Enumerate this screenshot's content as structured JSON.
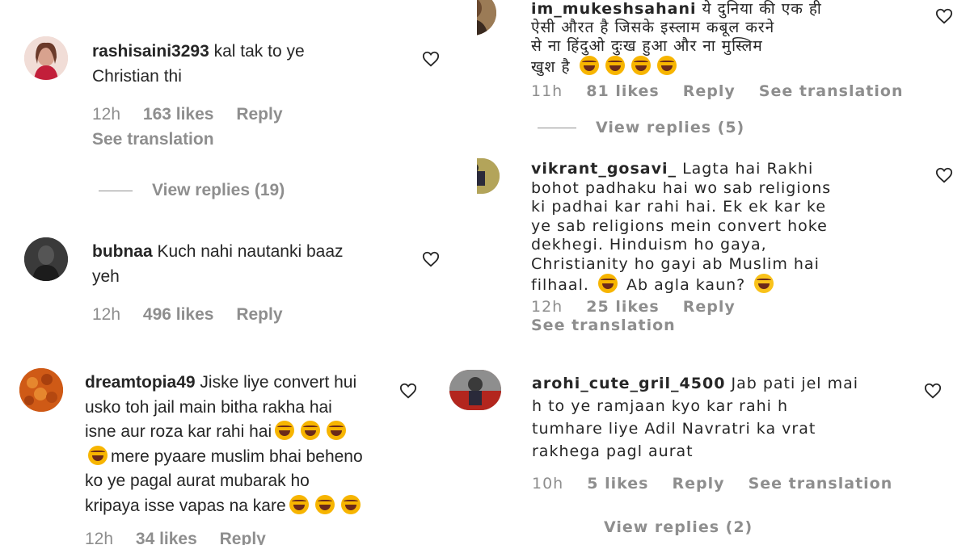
{
  "comments": {
    "rashisaini": {
      "username": "rashisaini3293",
      "line1": "kal tak to ye",
      "line2": "Christian thi",
      "time": "12h",
      "likes": "163 likes",
      "reply": "Reply",
      "see_translation": "See translation",
      "view_replies": "View replies (19)"
    },
    "bubnaa": {
      "username": "bubnaa",
      "line1": "Kuch nahi nautanki baaz",
      "line2": "yeh",
      "time": "12h",
      "likes": "496 likes",
      "reply": "Reply"
    },
    "mukesh": {
      "username": "im_mukeshsahani",
      "line1": "ये दुनिया की एक ही",
      "line2": "ऐसी औरत है जिसके इस्लाम कबूल करने",
      "line3": "से ना हिंदुओ दुःख हुआ और ना मुस्लिम",
      "line4": "खुश है",
      "time": "11h",
      "likes": "81 likes",
      "reply": "Reply",
      "see_translation": "See translation",
      "view_replies": "View replies (5)"
    },
    "vikrant": {
      "username": "vikrant_gosavi_",
      "line1": "Lagta hai Rakhi",
      "line2": "bohot padhaku hai wo sab religions",
      "line3": "ki padhai kar rahi hai. Ek ek kar ke",
      "line4": "ye sab religions mein convert hoke",
      "line5": "dekhegi. Hinduism ho gaya,",
      "line6": "Christianity ho gayi ab Muslim hai",
      "line7a": "filhaal.",
      "line7b": "Ab agla kaun?",
      "time": "12h",
      "likes": "25 likes",
      "reply": "Reply",
      "see_translation": "See translation"
    },
    "dreamtopia": {
      "username": "dreamtopia49",
      "line1": "Jiske liye convert hui",
      "line2": "usko toh jail main bitha rakha hai",
      "line3": "isne aur roza kar rahi hai",
      "line4": "mere pyaare muslim bhai beheno",
      "line5": "ko ye pagal aurat mubarak ho",
      "line6": "kripaya isse vapas na kare",
      "time": "12h",
      "likes": "34 likes",
      "reply": "Reply"
    },
    "arohi": {
      "username": "arohi_cute_gril_4500",
      "line1": "Jab pati jel mai",
      "line2": "h to ye ramjaan kyo kar rahi h",
      "line3": "tumhare liye Adil Navratri ka vrat",
      "line4": "rakhega pagl aurat",
      "time": "10h",
      "likes": "5 likes",
      "reply": "Reply",
      "see_translation": "See translation",
      "view_replies": "View replies (2)"
    }
  },
  "icons": {
    "heart": "heart-outline-icon",
    "emoji": "laughing-tears-emoji-icon"
  },
  "colors": {
    "text": "#262626",
    "muted": "#8e8e8e",
    "emoji": "#f7b500"
  }
}
